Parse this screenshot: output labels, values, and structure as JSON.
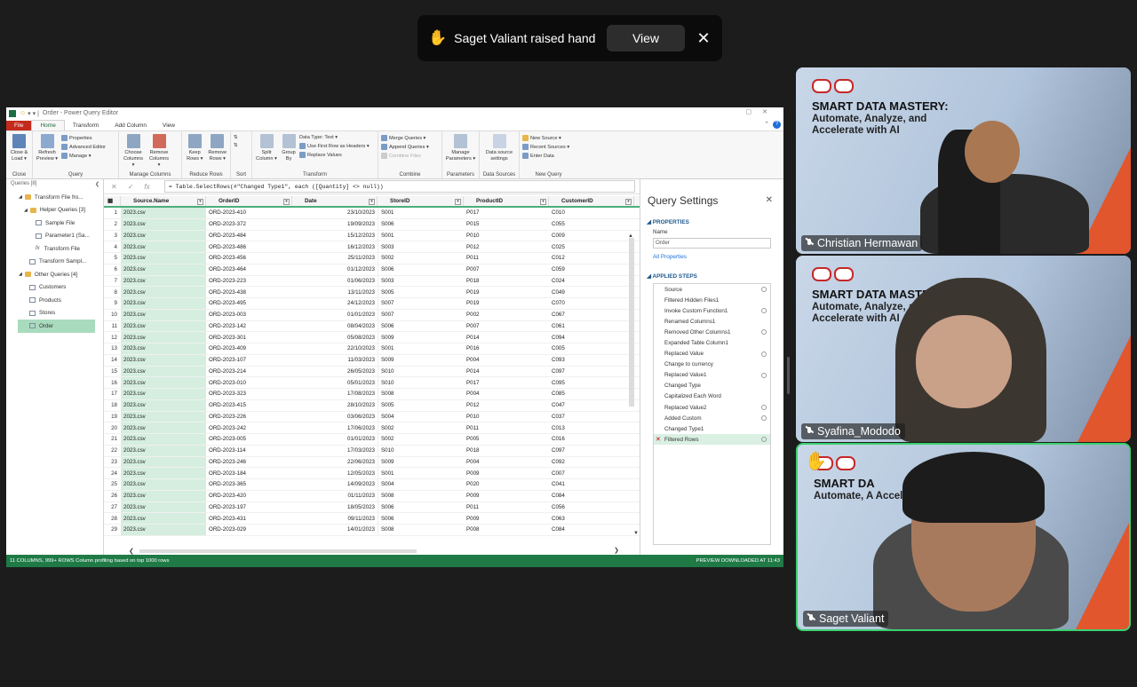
{
  "notification": {
    "icon": "raised-hand-icon",
    "message": "Saget Valiant raised hand",
    "view_label": "View",
    "close": "✕"
  },
  "pq": {
    "title": "Order - Power Query Editor",
    "tabs": [
      "File",
      "Home",
      "Transform",
      "Add Column",
      "View"
    ],
    "ribbon": {
      "close": {
        "btn": "Close & Load ▾",
        "label": "Close"
      },
      "query": {
        "refresh": "Refresh Preview ▾",
        "properties": "Properties",
        "advanced": "Advanced Editor",
        "manage": "Manage ▾",
        "label": "Query"
      },
      "manage_columns": {
        "choose": "Choose Columns ▾",
        "remove": "Remove Columns ▾",
        "label": "Manage Columns"
      },
      "reduce_rows": {
        "keep": "Keep Rows ▾",
        "remove": "Remove Rows ▾",
        "label": "Reduce Rows"
      },
      "sort": {
        "label": "Sort"
      },
      "transform": {
        "split": "Split Column ▾",
        "group": "Group By",
        "datatype": "Data Type: Text ▾",
        "firstrow": "Use First Row as Headers ▾",
        "replace": "Replace Values",
        "label": "Transform"
      },
      "combine": {
        "merge": "Merge Queries ▾",
        "append": "Append Queries ▾",
        "files": "Combine Files",
        "label": "Combine"
      },
      "parameters": {
        "manage": "Manage Parameters ▾",
        "label": "Parameters"
      },
      "datasources": {
        "settings": "Data source settings",
        "label": "Data Sources"
      },
      "newquery": {
        "new": "New Source ▾",
        "recent": "Recent Sources ▾",
        "enter": "Enter Data",
        "label": "New Query"
      }
    },
    "queries": {
      "header": "Queries [8]",
      "items": [
        "Transform File fro...",
        "Helper Queries [3]",
        "Sample File",
        "Parameter1 (Sa...",
        "Transform File",
        "Transform Sampl...",
        "Other Queries [4]",
        "Customers",
        "Products",
        "Stores",
        "Order"
      ]
    },
    "formula": "= Table.SelectRows(#\"Changed Type1\", each ([Quantity] <> null))",
    "columns": [
      "Source.Name",
      "OrderID",
      "Date",
      "StoreID",
      "ProductID",
      "CustomerID"
    ],
    "rows": [
      [
        "1",
        "2023.csv",
        "ORD-2023-410",
        "23/10/2023",
        "S001",
        "P017",
        "C010"
      ],
      [
        "2",
        "2023.csv",
        "ORD-2023-372",
        "19/09/2023",
        "S006",
        "P015",
        "C055"
      ],
      [
        "3",
        "2023.csv",
        "ORD-2023-484",
        "15/12/2023",
        "S001",
        "P010",
        "C009"
      ],
      [
        "4",
        "2023.csv",
        "ORD-2023-486",
        "16/12/2023",
        "S003",
        "P012",
        "C025"
      ],
      [
        "5",
        "2023.csv",
        "ORD-2023-456",
        "25/11/2023",
        "S002",
        "P011",
        "C012"
      ],
      [
        "6",
        "2023.csv",
        "ORD-2023-464",
        "01/12/2023",
        "S006",
        "P007",
        "C059"
      ],
      [
        "7",
        "2023.csv",
        "ORD-2023-223",
        "01/06/2023",
        "S003",
        "P018",
        "C024"
      ],
      [
        "8",
        "2023.csv",
        "ORD-2023-438",
        "13/11/2023",
        "S005",
        "P019",
        "C049"
      ],
      [
        "9",
        "2023.csv",
        "ORD-2023-495",
        "24/12/2023",
        "S007",
        "P019",
        "C070"
      ],
      [
        "10",
        "2023.csv",
        "ORD-2023-003",
        "01/01/2023",
        "S007",
        "P002",
        "C067"
      ],
      [
        "11",
        "2023.csv",
        "ORD-2023-142",
        "08/04/2023",
        "S006",
        "P007",
        "C061"
      ],
      [
        "12",
        "2023.csv",
        "ORD-2023-301",
        "05/08/2023",
        "S009",
        "P014",
        "C094"
      ],
      [
        "13",
        "2023.csv",
        "ORD-2023-409",
        "22/10/2023",
        "S001",
        "P016",
        "C005"
      ],
      [
        "14",
        "2023.csv",
        "ORD-2023-107",
        "11/03/2023",
        "S009",
        "P004",
        "C093"
      ],
      [
        "15",
        "2023.csv",
        "ORD-2023-214",
        "26/05/2023",
        "S010",
        "P014",
        "C097"
      ],
      [
        "16",
        "2023.csv",
        "ORD-2023-010",
        "05/01/2023",
        "S010",
        "P017",
        "C095"
      ],
      [
        "17",
        "2023.csv",
        "ORD-2023-323",
        "17/08/2023",
        "S008",
        "P004",
        "C085"
      ],
      [
        "18",
        "2023.csv",
        "ORD-2023-415",
        "28/10/2023",
        "S005",
        "P012",
        "C047"
      ],
      [
        "19",
        "2023.csv",
        "ORD-2023-226",
        "03/06/2023",
        "S004",
        "P010",
        "C037"
      ],
      [
        "20",
        "2023.csv",
        "ORD-2023-242",
        "17/06/2023",
        "S002",
        "P011",
        "C013"
      ],
      [
        "21",
        "2023.csv",
        "ORD-2023-005",
        "01/01/2023",
        "S002",
        "P005",
        "C016"
      ],
      [
        "22",
        "2023.csv",
        "ORD-2023-114",
        "17/03/2023",
        "S010",
        "P018",
        "C097"
      ],
      [
        "23",
        "2023.csv",
        "ORD-2023-246",
        "22/06/2023",
        "S009",
        "P004",
        "C092"
      ],
      [
        "24",
        "2023.csv",
        "ORD-2023-184",
        "12/05/2023",
        "S001",
        "P009",
        "C007"
      ],
      [
        "25",
        "2023.csv",
        "ORD-2023-365",
        "14/09/2023",
        "S004",
        "P020",
        "C041"
      ],
      [
        "26",
        "2023.csv",
        "ORD-2023-420",
        "01/11/2023",
        "S008",
        "P009",
        "C084"
      ],
      [
        "27",
        "2023.csv",
        "ORD-2023-197",
        "18/05/2023",
        "S006",
        "P011",
        "C056"
      ],
      [
        "28",
        "2023.csv",
        "ORD-2023-431",
        "09/11/2023",
        "S006",
        "P009",
        "C063"
      ],
      [
        "29",
        "2023.csv",
        "ORD-2023-029",
        "14/01/2023",
        "S008",
        "P008",
        "C084"
      ]
    ],
    "settings": {
      "title": "Query Settings",
      "properties": "PROPERTIES",
      "name_label": "Name",
      "name_value": "Order",
      "all_properties": "All Properties",
      "applied_steps": "APPLIED STEPS",
      "steps": [
        "Source",
        "Filtered Hidden Files1",
        "Invoke Custom Function1",
        "Renamed Columns1",
        "Removed Other Columns1",
        "Expanded Table Column1",
        "Replaced Value",
        "Change to currency",
        "Replaced Value1",
        "Changed Type",
        "Capitalized Each Word",
        "Replaced Value2",
        "Added Custom",
        "Changed Type1",
        "Filtered Rows"
      ]
    },
    "status": {
      "left": "11 COLUMNS, 999+ ROWS    Column profiling based on top 1000 rows",
      "right": "PREVIEW DOWNLOADED AT 11:43"
    }
  },
  "participants": [
    {
      "name": "Christian Hermawan",
      "banner": "SMART DATA MASTERY:",
      "sub": "Automate, Analyze, and Accelerate with AI"
    },
    {
      "name": "Syafina_Mododo",
      "banner": "SMART DATA MASTE",
      "sub": "Automate, Analyze, an Accelerate with AI"
    },
    {
      "name": "Saget Valiant",
      "banner": "SMART DA",
      "sub": "Automate, A Accelerate w"
    }
  ]
}
